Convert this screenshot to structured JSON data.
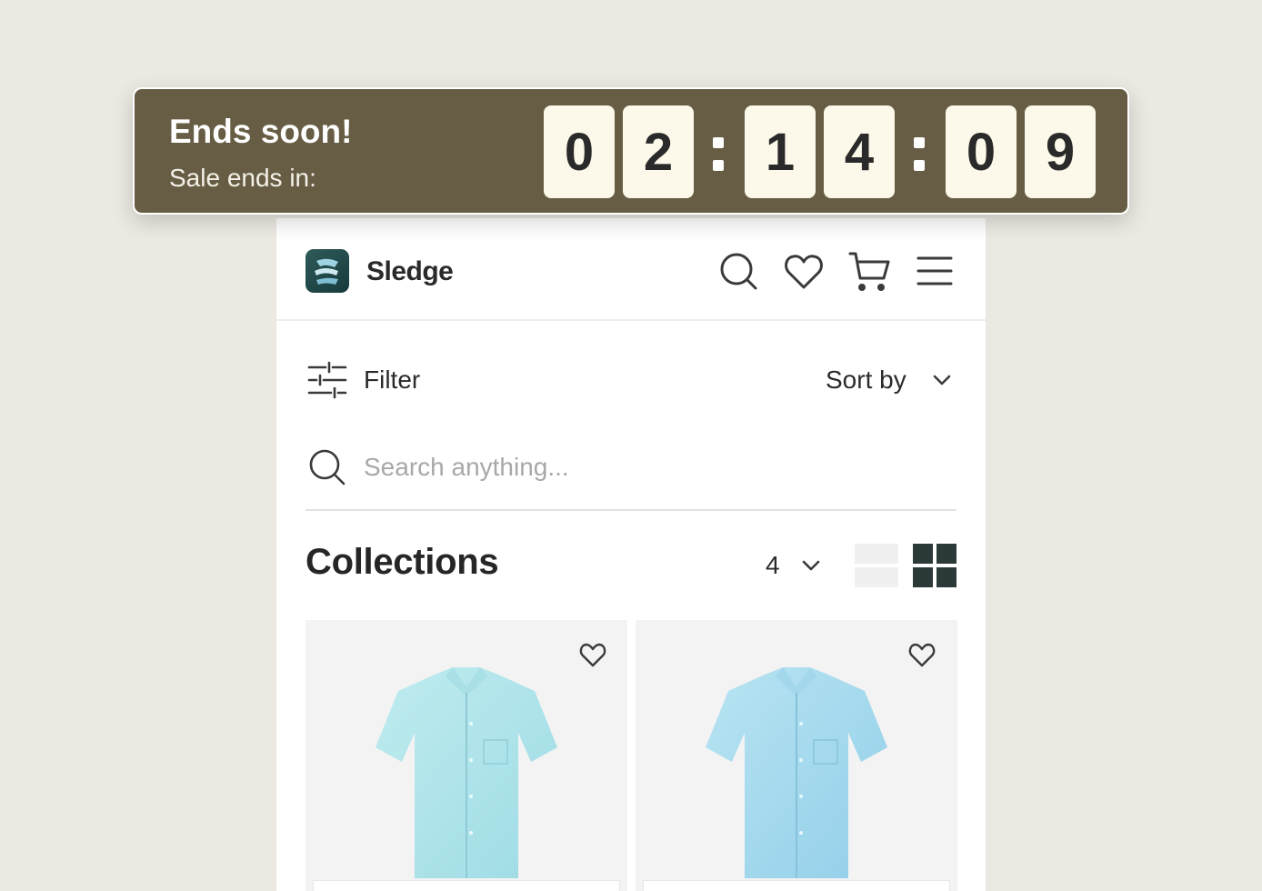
{
  "banner": {
    "title": "Ends soon!",
    "subtitle": "Sale ends in:",
    "countdown": {
      "hours": [
        "0",
        "2"
      ],
      "minutes": [
        "1",
        "4"
      ],
      "seconds": [
        "0",
        "9"
      ]
    },
    "colors": {
      "background": "#675d44",
      "digit_bg": "#fdf9ea"
    }
  },
  "header": {
    "brand": "Sledge",
    "icons": [
      "search-icon",
      "heart-icon",
      "cart-icon",
      "menu-icon"
    ]
  },
  "toolbar": {
    "filter_label": "Filter",
    "sort_label": "Sort by"
  },
  "search": {
    "placeholder": "Search anything...",
    "value": ""
  },
  "collections": {
    "title": "Collections",
    "columns_value": "4",
    "view_modes": [
      "list-view",
      "grid-view"
    ],
    "active_view": "grid-view",
    "products": [
      {
        "image": "light-blue-short-sleeve-shirt",
        "favorite_icon": "heart-icon"
      },
      {
        "image": "light-blue-short-sleeve-shirt",
        "favorite_icon": "heart-icon"
      }
    ]
  }
}
